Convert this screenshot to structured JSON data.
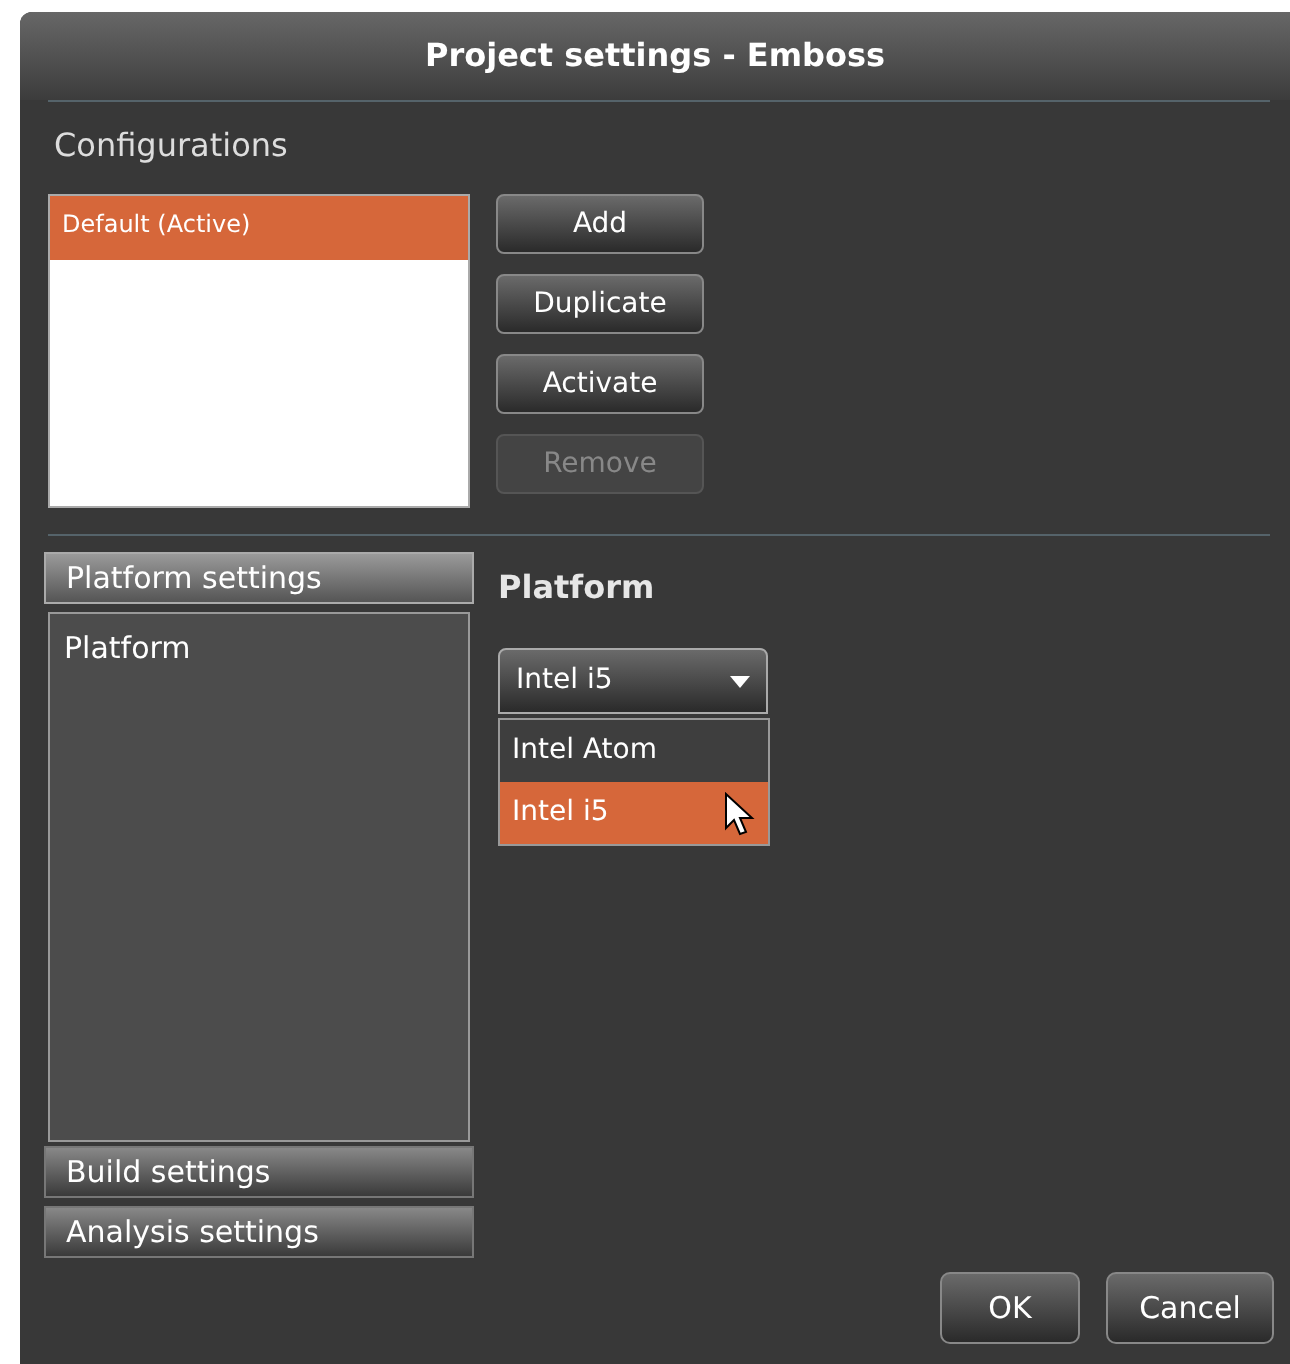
{
  "window": {
    "title": "Project settings - Emboss"
  },
  "configurations": {
    "heading": "Configurations",
    "items": [
      {
        "label": "Default (Active)",
        "selected": true
      }
    ],
    "buttons": [
      {
        "label": "Add",
        "disabled": false
      },
      {
        "label": "Duplicate",
        "disabled": false
      },
      {
        "label": "Activate",
        "disabled": false
      },
      {
        "label": "Remove",
        "disabled": true
      }
    ]
  },
  "sections": [
    {
      "label": "Platform settings",
      "expanded": true,
      "items": [
        {
          "label": "Platform"
        }
      ]
    },
    {
      "label": "Build settings",
      "expanded": false
    },
    {
      "label": "Analysis settings",
      "expanded": false
    }
  ],
  "platform": {
    "heading": "Platform",
    "dropdown": {
      "value": "Intel i5",
      "open": true,
      "options": [
        {
          "label": "Intel Atom",
          "selected": false
        },
        {
          "label": "Intel i5",
          "selected": true
        }
      ]
    }
  },
  "buttons": [
    "OK",
    "Cancel"
  ]
}
